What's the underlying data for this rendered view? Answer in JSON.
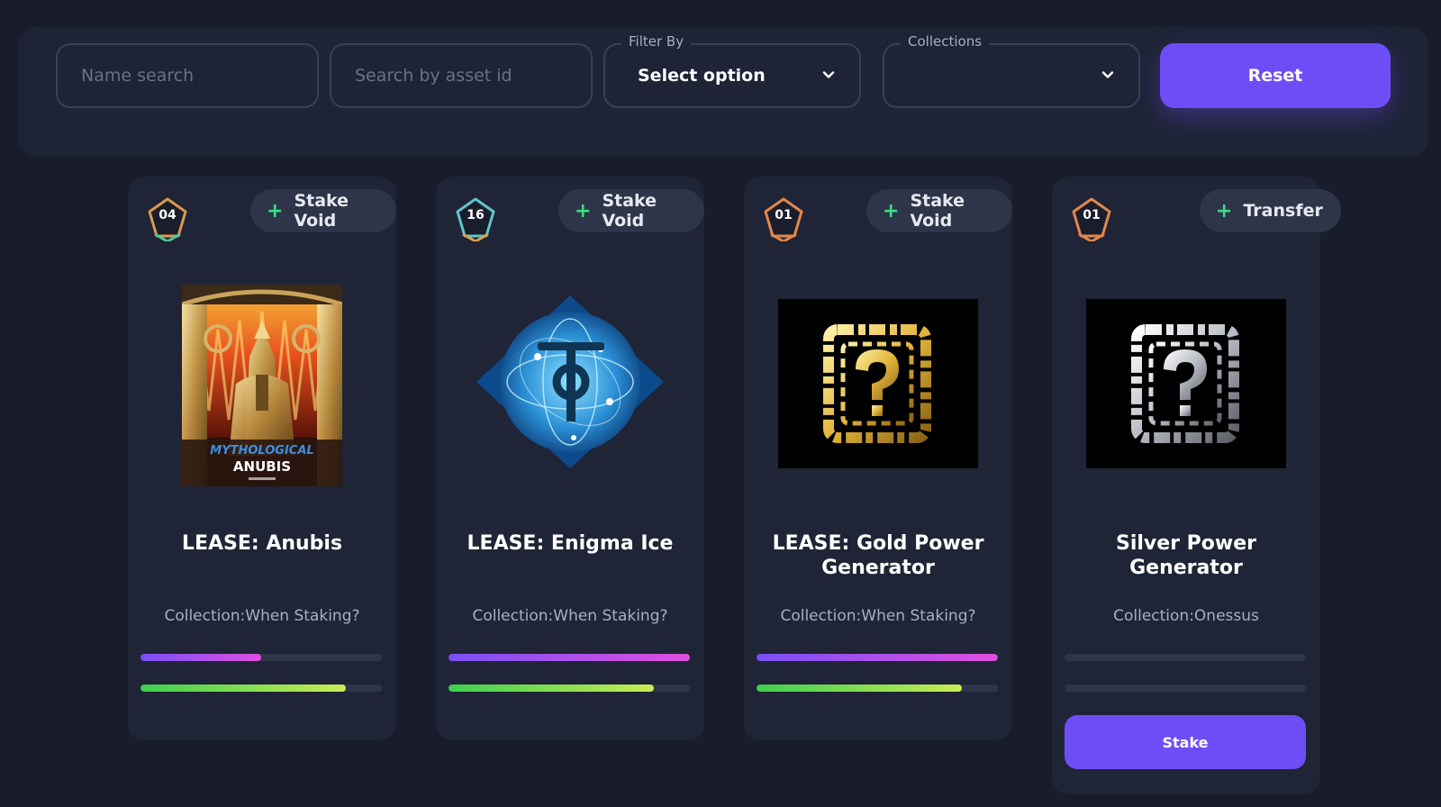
{
  "filters": {
    "name_search_placeholder": "Name search",
    "asset_search_placeholder": "Search by asset id",
    "filter_by": {
      "label": "Filter By",
      "value": "Select option"
    },
    "collections": {
      "label": "Collections",
      "value": ""
    },
    "reset_label": "Reset"
  },
  "colors": {
    "accent": "#6d4ef6",
    "background": "#181c2b",
    "card": "#1f2436",
    "plus": "#3ddc84"
  },
  "cards": [
    {
      "badge": "04",
      "badge_color": "#4ec9a0",
      "action": "Stake Void",
      "title": "LEASE: Anubis",
      "collection": "Collection:When Staking?",
      "bar_purple": 0.5,
      "bar_green": 0.85
    },
    {
      "badge": "16",
      "badge_color": "#5fc7c9",
      "action": "Stake Void",
      "title": "LEASE: Enigma Ice",
      "collection": "Collection:When Staking?",
      "bar_purple": 1.0,
      "bar_green": 0.85
    },
    {
      "badge": "01",
      "badge_color": "#e3874a",
      "action": "Stake Void",
      "title": "LEASE: Gold Power Generator",
      "collection": "Collection:When Staking?",
      "bar_purple": 1.0,
      "bar_green": 0.85
    },
    {
      "badge": "01",
      "badge_color": "#e3874a",
      "action": "Transfer",
      "title": "Silver Power Generator",
      "collection": "Collection:Onessus",
      "bar_purple": 0,
      "bar_green": 0,
      "stake_label": "Stake"
    }
  ],
  "art": {
    "anubis_logo": "MYTHOLOGICAL",
    "anubis_name": "ANUBIS"
  }
}
